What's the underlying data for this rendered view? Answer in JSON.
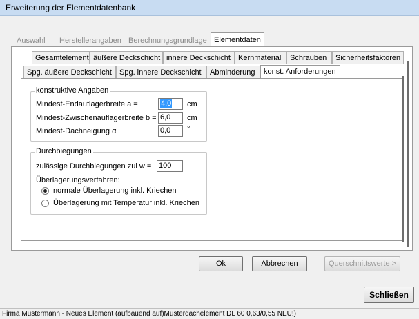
{
  "window": {
    "title": "Erweiterung der Elementdatenbank"
  },
  "tabs_row1": [
    {
      "label": "Auswahl",
      "state": "disabled"
    },
    {
      "label": "Herstellerangaben",
      "state": "disabled"
    },
    {
      "label": "Berechnungsgrundlage",
      "state": "disabled"
    },
    {
      "label": "Elementdaten",
      "state": "selected"
    }
  ],
  "tabs_row2": [
    {
      "label": "Gesamtelement"
    },
    {
      "label": "äußere Deckschicht"
    },
    {
      "label": "innere Deckschicht"
    },
    {
      "label": "Kernmaterial"
    },
    {
      "label": "Schrauben"
    },
    {
      "label": "Sicherheitsfaktoren"
    }
  ],
  "tabs_row3": [
    {
      "label": "Spg. äußere Deckschicht"
    },
    {
      "label": "Spg. innere Deckschicht"
    },
    {
      "label": "Abminderung"
    },
    {
      "label": "konst. Anforderungen",
      "state": "selected"
    }
  ],
  "group_konstruktiv": {
    "title": "konstruktive Angaben",
    "rows": [
      {
        "label": "Mindest-Endauflagerbreite a =",
        "value": "4,0",
        "unit": "cm"
      },
      {
        "label": "Mindest-Zwischenauflagerbreite b =",
        "value": "6,0",
        "unit": "cm"
      },
      {
        "label": "Mindest-Dachneigung α",
        "value": "0,0",
        "unit": "°"
      }
    ]
  },
  "group_durchbiegung": {
    "title": "Durchbiegungen",
    "zul_label": "zulässige Durchbiegungen zul w =",
    "zul_value": "100",
    "verfahren_label": "Überlagerungsverfahren:",
    "options": [
      {
        "label": "normale Überlagerung inkl. Kriechen",
        "checked": true
      },
      {
        "label": "Überlagerung mit Temperatur inkl. Kriechen",
        "checked": false
      }
    ]
  },
  "buttons": {
    "ok": "Ok",
    "cancel": "Abbrechen",
    "querschnitt": "Querschnittswerte >",
    "close": "Schließen"
  },
  "status": "Firma Mustermann - Neues Element  (aufbauend auf)Musterdachelement DL 60 0,63/0,55 NEU!)"
}
